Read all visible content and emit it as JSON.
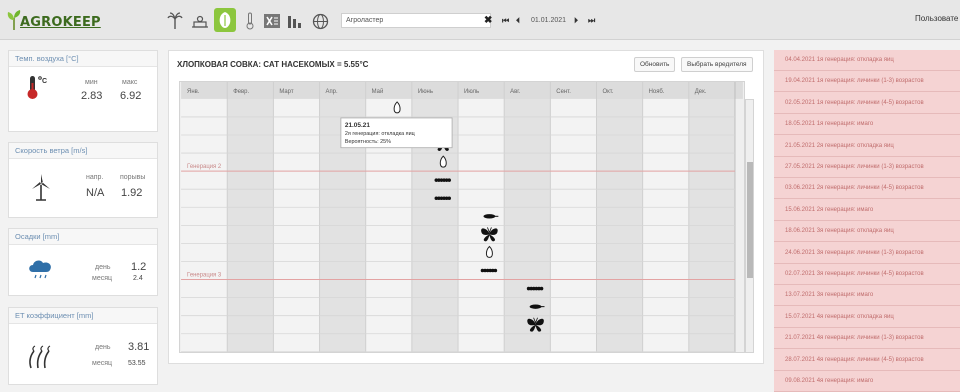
{
  "app": {
    "logo_text": "AGROKEEP",
    "user_label": "Пользовате"
  },
  "toolbar": {
    "icons": [
      "palm-icon",
      "weather-station-icon",
      "crop-protection-icon",
      "thermometer-icon",
      "excel-icon",
      "bar-chart-icon",
      "globe-icon"
    ],
    "active_icon": "crop-protection-icon",
    "station": "Агроластер",
    "clear": "✖",
    "nav_first": "⏮",
    "nav_prev": "⏴",
    "date": "01.01.2021",
    "nav_next": "⏵",
    "nav_last": "⏭"
  },
  "weather": {
    "temp": {
      "title": "Темп. воздуха [°C]",
      "min_label": "мин",
      "max_label": "макс",
      "min": "2.83",
      "max": "6.92"
    },
    "wind": {
      "title": "Скорость ветра [m/s]",
      "dir_label": "напр.",
      "gust_label": "порывы",
      "dir": "N/A",
      "gust": "1.92"
    },
    "rain": {
      "title": "Осадки [mm]",
      "day_label": "день",
      "month_label": "месяц",
      "day": "1.2",
      "month": "2.4"
    },
    "et": {
      "title": "ET коэффициент [mm]",
      "day_label": "день",
      "month_label": "месяц",
      "day": "3.81",
      "month": "53.55"
    }
  },
  "panel": {
    "title": "ХЛОПКОВАЯ СОВКА: САТ НАСЕКОМЫХ = 5.55°C",
    "refresh_label": "Обновить",
    "select_pest_label": "Выбрать вредителя"
  },
  "chart_data": {
    "type": "table",
    "months": [
      "Янв.",
      "Февр.",
      "Март",
      "Апр.",
      "Май",
      "Июнь",
      "Июль",
      "Авг.",
      "Сент.",
      "Окт.",
      "Нояб.",
      "Дек."
    ],
    "generation_labels": [
      "Генерация 2",
      "Генерация 3"
    ],
    "tooltip": {
      "date": "21.05.21",
      "stage": "2я генерация: откладка яиц",
      "probability": "Вероятность: 25%"
    },
    "events": [
      {
        "month": 4,
        "row": 1,
        "stage": "egg"
      },
      {
        "month": 5,
        "row": 3,
        "stage": "adult"
      },
      {
        "month": 5,
        "row": 4,
        "stage": "egg"
      },
      {
        "month": 5,
        "row": 5,
        "stage": "larva"
      },
      {
        "month": 5,
        "row": 6,
        "stage": "larva"
      },
      {
        "month": 6,
        "row": 7,
        "stage": "pupa"
      },
      {
        "month": 6,
        "row": 8,
        "stage": "adult"
      },
      {
        "month": 6,
        "row": 9,
        "stage": "egg"
      },
      {
        "month": 6,
        "row": 10,
        "stage": "larva"
      },
      {
        "month": 7,
        "row": 11,
        "stage": "larva"
      },
      {
        "month": 7,
        "row": 12,
        "stage": "pupa"
      },
      {
        "month": 7,
        "row": 13,
        "stage": "adult"
      }
    ]
  },
  "alerts": [
    "04.04.2021 1я генерация: откладка яиц",
    "19.04.2021 1я генерация: личинки (1-3) возрастов",
    "02.05.2021 1я генерация: личинки (4-5) возрастов",
    "18.05.2021 1я генерация: имаго",
    "21.05.2021 2я генерация: откладка яиц",
    "27.05.2021 2я генерация: личинки (1-3) возрастов",
    "03.06.2021 2я генерация: личинки (4-5) возрастов",
    "15.06.2021 2я генерация: имаго",
    "18.06.2021 3я генерация: откладка яиц",
    "24.06.2021 3я генерация: личинки (1-3) возрастов",
    "02.07.2021 3я генерация: личинки (4-5) возрастов",
    "13.07.2021 3я генерация: имаго",
    "15.07.2021 4я генерация: откладка яиц",
    "21.07.2021 4я генерация: личинки (1-3) возрастов",
    "28.07.2021 4я генерация: личинки (4-5) возрастов",
    "09.08.2021 4я генерация: имаго"
  ],
  "colors": {
    "accent": "#8cc63e",
    "alert_bg": "#f5d3d3",
    "alert_text": "#c06d6d",
    "generation_line": "#e3a3a3"
  }
}
